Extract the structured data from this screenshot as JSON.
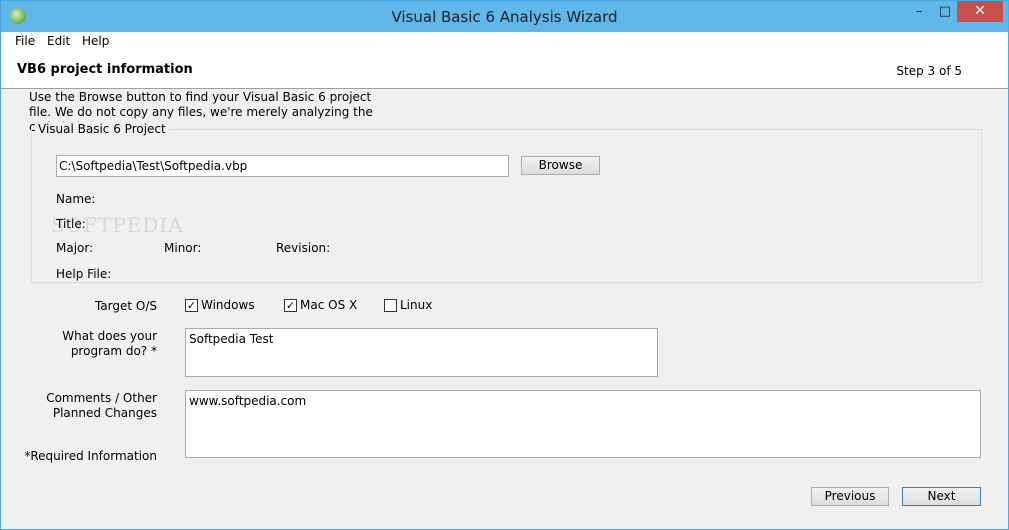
{
  "window": {
    "title": "Visual Basic 6 Analysis Wizard",
    "minimize": "–",
    "maximize": "□",
    "close": "✕"
  },
  "menu": [
    "File",
    "Edit",
    "Help"
  ],
  "header": {
    "title": "VB6 project information",
    "step": "Step 3 of 5"
  },
  "description": "Use the Browse button to find your Visual Basic 6 project file.  We do not copy any files, we're merely analyzing  the code in it.",
  "project": {
    "legend": "Visual Basic 6 Project",
    "path_value": "C:\\Softpedia\\Test\\Softpedia.vbp",
    "browse_label": "Browse",
    "name_label": "Name:",
    "title_label": "Title:",
    "major_label": "Major:",
    "minor_label": "Minor:",
    "revision_label": "Revision:",
    "help_file_label": "Help File:"
  },
  "watermark": "SOFTPEDIA",
  "target_os": {
    "label": "Target O/S",
    "options": [
      {
        "label": "Windows",
        "checked": true
      },
      {
        "label": "Mac OS X",
        "checked": true
      },
      {
        "label": "Linux",
        "checked": false
      }
    ]
  },
  "purpose": {
    "label": "What does your program do? *",
    "value": "Softpedia Test"
  },
  "comments": {
    "label": "Comments / Other Planned Changes",
    "value": "www.softpedia.com"
  },
  "required_note": "*Required Information",
  "buttons": {
    "previous": "Previous",
    "next": "Next"
  }
}
